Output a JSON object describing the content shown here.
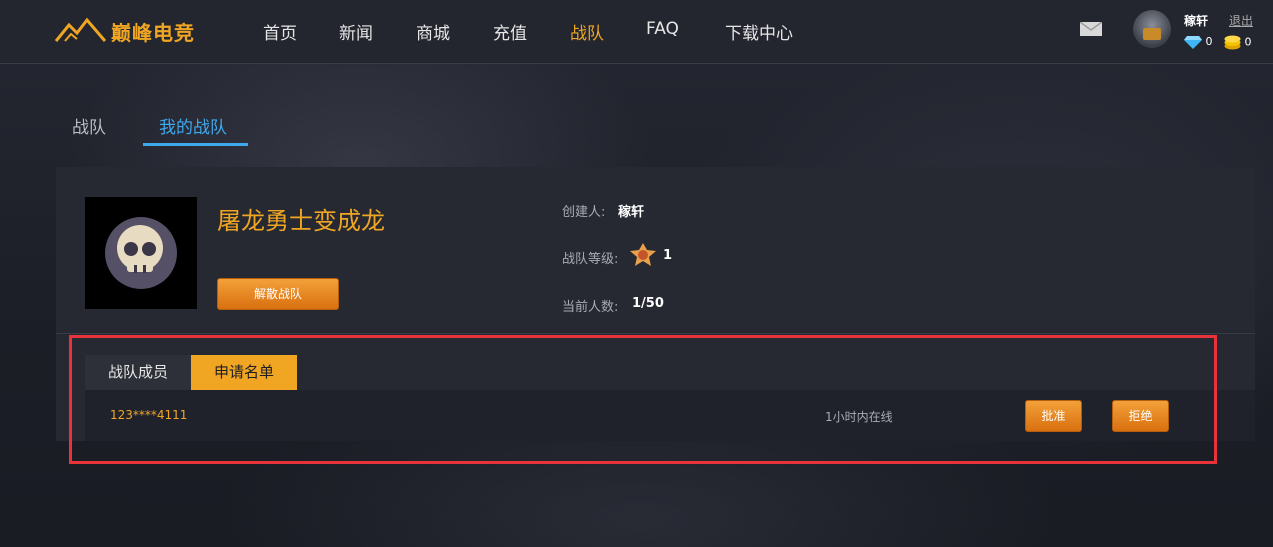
{
  "header": {
    "logo_text": "巅峰电竞",
    "nav": [
      "首页",
      "新闻",
      "商城",
      "充值",
      "战队",
      "FAQ",
      "下载中心"
    ],
    "active_nav": "战队",
    "username": "稼轩",
    "logout": "退出",
    "diamonds": "0",
    "coins": "0"
  },
  "tabs": [
    "战队",
    "我的战队"
  ],
  "team": {
    "name": "屠龙勇士变成龙",
    "dissolve_label": "解散战队",
    "creator_label": "创建人:",
    "creator": "稼轩",
    "level_label": "战队等级:",
    "level": "1",
    "members_label": "当前人数:",
    "members": "1/50"
  },
  "subtabs": [
    "战队成员",
    "申请名单"
  ],
  "applications": [
    {
      "user": "123****4111",
      "status": "1小时内在线",
      "approve": "批准",
      "reject": "拒绝"
    }
  ],
  "colors": {
    "accent": "#f0a623",
    "tab_active": "#3fa9ee",
    "highlight": "#e8333a"
  }
}
